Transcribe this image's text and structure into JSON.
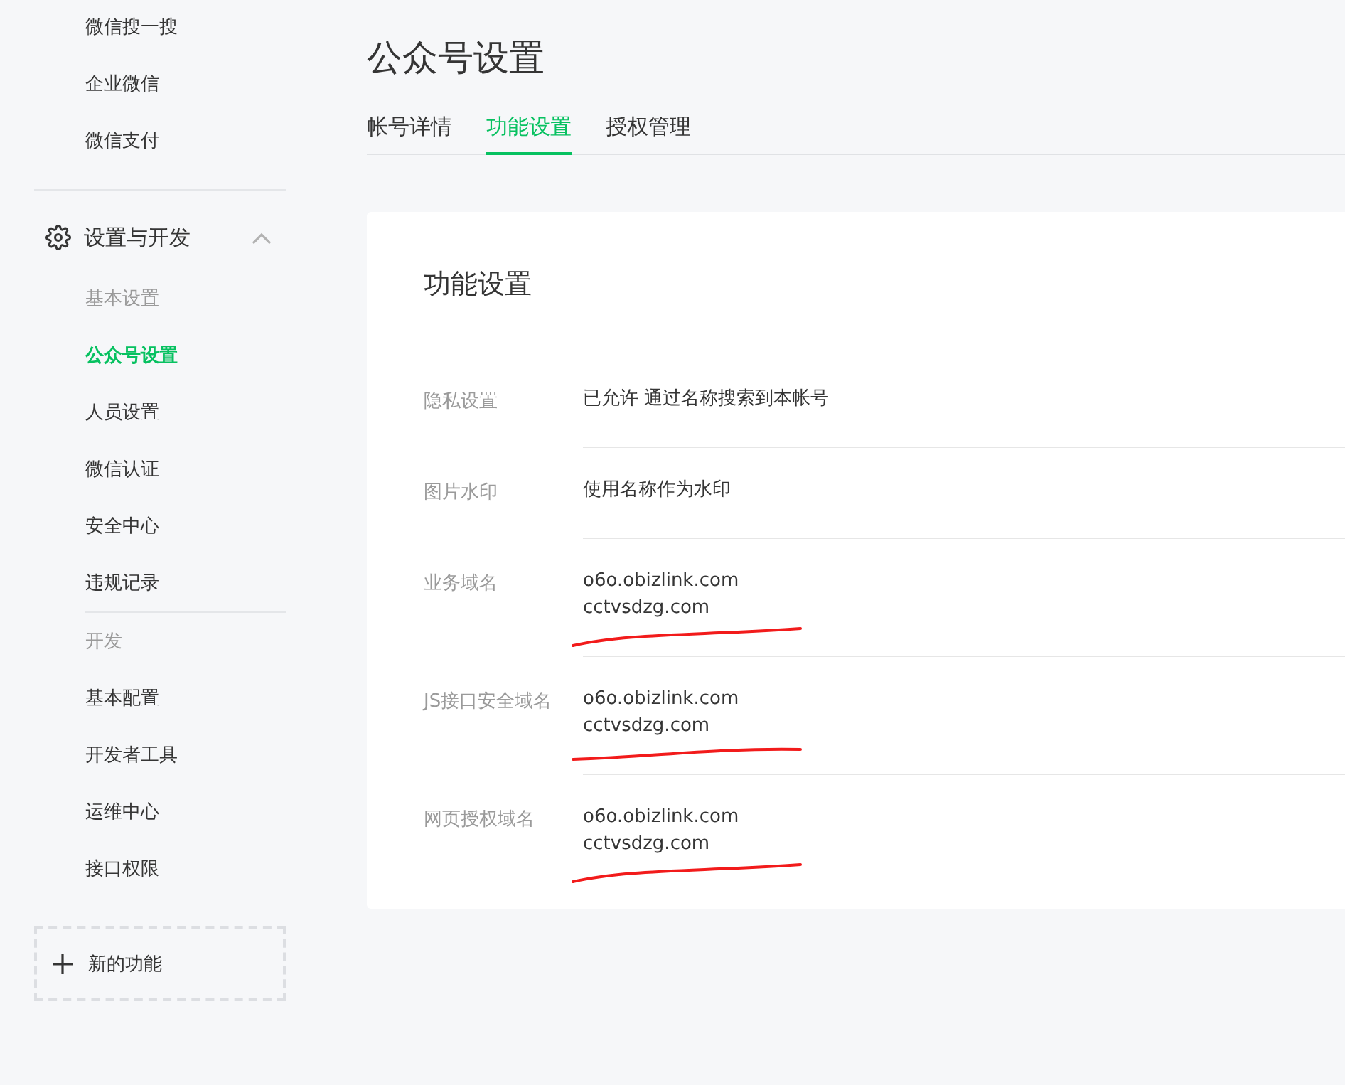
{
  "sidebar": {
    "top_items": [
      {
        "label": "微信搜一搜"
      },
      {
        "label": "企业微信"
      },
      {
        "label": "微信支付"
      }
    ],
    "section": {
      "label": "设置与开发",
      "expanded": true,
      "groups": [
        {
          "heading": "基本设置",
          "items": [
            {
              "label": "公众号设置",
              "selected": true
            },
            {
              "label": "人员设置",
              "selected": false
            },
            {
              "label": "微信认证",
              "selected": false
            },
            {
              "label": "安全中心",
              "selected": false
            },
            {
              "label": "违规记录",
              "selected": false
            }
          ]
        },
        {
          "heading": "开发",
          "items": [
            {
              "label": "基本配置",
              "selected": false
            },
            {
              "label": "开发者工具",
              "selected": false
            },
            {
              "label": "运维中心",
              "selected": false
            },
            {
              "label": "接口权限",
              "selected": false
            }
          ]
        }
      ]
    },
    "new_feature": {
      "label": "新的功能"
    }
  },
  "page": {
    "title": "公众号设置",
    "tabs": [
      {
        "label": "帐号详情",
        "selected": false
      },
      {
        "label": "功能设置",
        "selected": true
      },
      {
        "label": "授权管理",
        "selected": false
      }
    ]
  },
  "card": {
    "title": "功能设置",
    "rows": [
      {
        "label": "隐私设置",
        "values": [
          "已允许 通过名称搜索到本帐号"
        ],
        "marked": false
      },
      {
        "label": "图片水印",
        "values": [
          "使用名称作为水印"
        ],
        "marked": false
      },
      {
        "label": "业务域名",
        "values": [
          "o6o.obizlink.com",
          "cctvsdzg.com"
        ],
        "marked": true
      },
      {
        "label": "JS接口安全域名",
        "values": [
          "o6o.obizlink.com",
          "cctvsdzg.com"
        ],
        "marked": true
      },
      {
        "label": "网页授权域名",
        "values": [
          "o6o.obizlink.com",
          "cctvsdzg.com"
        ],
        "marked": true
      }
    ]
  }
}
